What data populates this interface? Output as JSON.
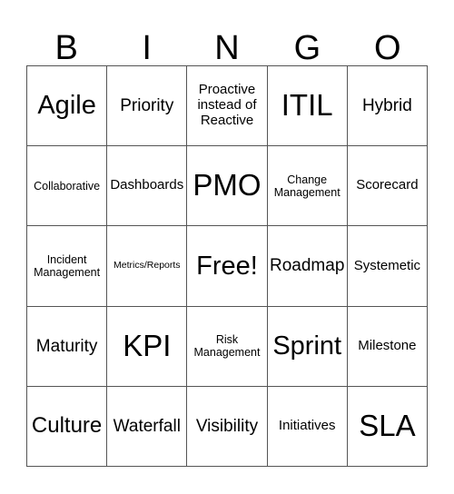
{
  "card": {
    "title": "BINGO",
    "header_letters": [
      "B",
      "I",
      "N",
      "G",
      "O"
    ],
    "grid_size": "5x5",
    "free_space_label": "Free!",
    "colors": {
      "background": "#ffffff",
      "text": "#000000",
      "grid_line": "#555555"
    },
    "columns": [
      {
        "letter": "B",
        "cells": [
          {
            "text": "Agile",
            "size": "xl"
          },
          {
            "text": "Collaborative",
            "size": "xs"
          },
          {
            "text": "Incident\nManagement",
            "size": "xs"
          },
          {
            "text": "Maturity",
            "size": "md"
          },
          {
            "text": "Culture",
            "size": "lg"
          }
        ]
      },
      {
        "letter": "I",
        "cells": [
          {
            "text": "Priority",
            "size": "md"
          },
          {
            "text": "Dashboards",
            "size": "sm"
          },
          {
            "text": "Metrics/Reports",
            "size": "xxs"
          },
          {
            "text": "KPI",
            "size": "xxl"
          },
          {
            "text": "Waterfall",
            "size": "md"
          }
        ]
      },
      {
        "letter": "N",
        "cells": [
          {
            "text": "Proactive\ninstead of\nReactive",
            "size": "sm"
          },
          {
            "text": "PMO",
            "size": "xxl"
          },
          {
            "text": "Free!",
            "size": "xl"
          },
          {
            "text": "Risk\nManagement",
            "size": "xs"
          },
          {
            "text": "Visibility",
            "size": "md"
          }
        ]
      },
      {
        "letter": "G",
        "cells": [
          {
            "text": "ITIL",
            "size": "xxl"
          },
          {
            "text": "Change\nManagement",
            "size": "xs"
          },
          {
            "text": "Roadmap",
            "size": "md"
          },
          {
            "text": "Sprint",
            "size": "xl"
          },
          {
            "text": "Initiatives",
            "size": "sm"
          }
        ]
      },
      {
        "letter": "O",
        "cells": [
          {
            "text": "Hybrid",
            "size": "md"
          },
          {
            "text": "Scorecard",
            "size": "sm"
          },
          {
            "text": "Systemetic",
            "size": "sm"
          },
          {
            "text": "Milestone",
            "size": "sm"
          },
          {
            "text": "SLA",
            "size": "xxl"
          }
        ]
      }
    ],
    "rows": [
      [
        "Agile",
        "Priority",
        "Proactive instead of Reactive",
        "ITIL",
        "Hybrid"
      ],
      [
        "Collaborative",
        "Dashboards",
        "PMO",
        "Change Management",
        "Scorecard"
      ],
      [
        "Incident Management",
        "Metrics/Reports",
        "Free!",
        "Roadmap",
        "Systemetic"
      ],
      [
        "Maturity",
        "KPI",
        "Risk Management",
        "Sprint",
        "Milestone"
      ],
      [
        "Culture",
        "Waterfall",
        "Visibility",
        "Initiatives",
        "SLA"
      ]
    ]
  }
}
